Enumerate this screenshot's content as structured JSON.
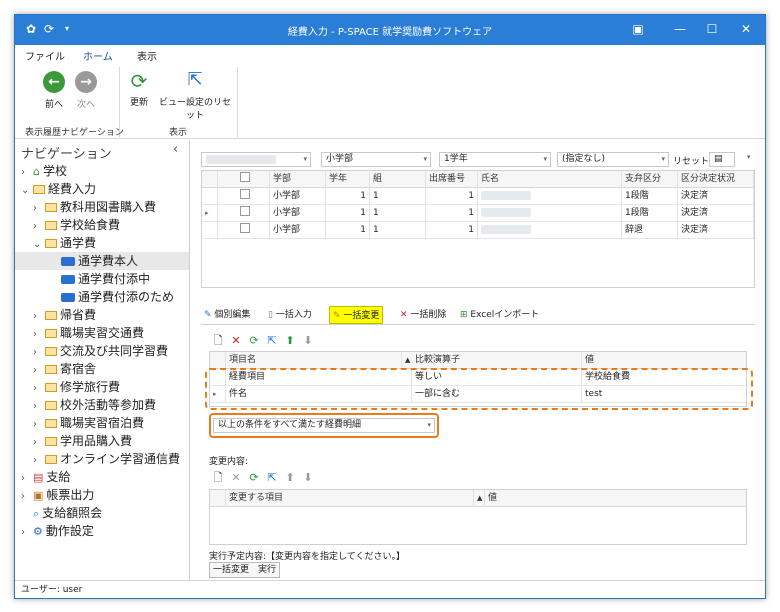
{
  "window": {
    "title": "経費入力 - P-SPACE 就学奨励費ソフトウェア"
  },
  "menu": [
    "ファイル",
    "ホーム",
    "表示"
  ],
  "ribbon": {
    "back": "前へ",
    "forward": "次へ",
    "refresh": "更新",
    "reset_view": "ビュー設定のリセット",
    "group_history": "表示履歴ナビゲーション",
    "group_view": "表示"
  },
  "nav": {
    "header": "ナビゲーション",
    "collapse": "‹",
    "items": [
      {
        "label": "学校",
        "arrow": "›"
      },
      {
        "label": "経費入力",
        "arrow": "⌄"
      },
      {
        "label": "教科用図書購入費",
        "arrow": "›"
      },
      {
        "label": "学校給食費",
        "arrow": "›"
      },
      {
        "label": "通学費",
        "arrow": "⌄"
      },
      {
        "label": "通学費本人",
        "arrow": ""
      },
      {
        "label": "通学費付添中",
        "arrow": ""
      },
      {
        "label": "通学費付添のため",
        "arrow": ""
      },
      {
        "label": "帰省費",
        "arrow": "›"
      },
      {
        "label": "職場実習交通費",
        "arrow": "›"
      },
      {
        "label": "交流及び共同学習費",
        "arrow": "›"
      },
      {
        "label": "寄宿舎",
        "arrow": "›"
      },
      {
        "label": "修学旅行費",
        "arrow": "›"
      },
      {
        "label": "校外活動等参加費",
        "arrow": "›"
      },
      {
        "label": "職場実習宿泊費",
        "arrow": "›"
      },
      {
        "label": "学用品購入費",
        "arrow": "›"
      },
      {
        "label": "オンライン学習通信費",
        "arrow": "›"
      },
      {
        "label": "支給",
        "arrow": "›"
      },
      {
        "label": "帳票出力",
        "arrow": "›"
      },
      {
        "label": "支給額照会",
        "arrow": ""
      },
      {
        "label": "動作設定",
        "arrow": "›"
      }
    ]
  },
  "filters": {
    "dept": "小学部",
    "grade": "1学年",
    "other": "(指定なし)",
    "reset": "リセット"
  },
  "student_grid": {
    "headers": [
      "学部",
      "学年",
      "組",
      "出席番号",
      "氏名",
      "支弁区分",
      "区分決定状況"
    ],
    "rows": [
      {
        "dept": "小学部",
        "grade": "1",
        "cls": "1",
        "num": "1",
        "div": "1段階",
        "status": "決定済"
      },
      {
        "dept": "小学部",
        "grade": "1",
        "cls": "1",
        "num": "1",
        "div": "1段階",
        "status": "決定済"
      },
      {
        "dept": "小学部",
        "grade": "1",
        "cls": "1",
        "num": "1",
        "div": "辞退",
        "status": "決定済"
      }
    ]
  },
  "tabs": [
    "個別編集",
    "一括入力",
    "一括変更",
    "一括削除",
    "Excelインポート"
  ],
  "cond_grid": {
    "headers": [
      "項目名",
      "比較演算子",
      "値"
    ],
    "rows": [
      {
        "item": "経費項目",
        "op": "等しい",
        "value": "学校給食費"
      },
      {
        "item": "件名",
        "op": "一部に含む",
        "value": "test"
      }
    ]
  },
  "condition_mode": "以上の条件をすべて満たす経費明細",
  "change_label": "変更内容:",
  "change_grid": {
    "headers": [
      "変更する項目",
      "値"
    ]
  },
  "plan_text": "実行予定内容:【変更内容を指定してください。】",
  "run_button": "一括変更　実行",
  "status": "ユーザー: user"
}
